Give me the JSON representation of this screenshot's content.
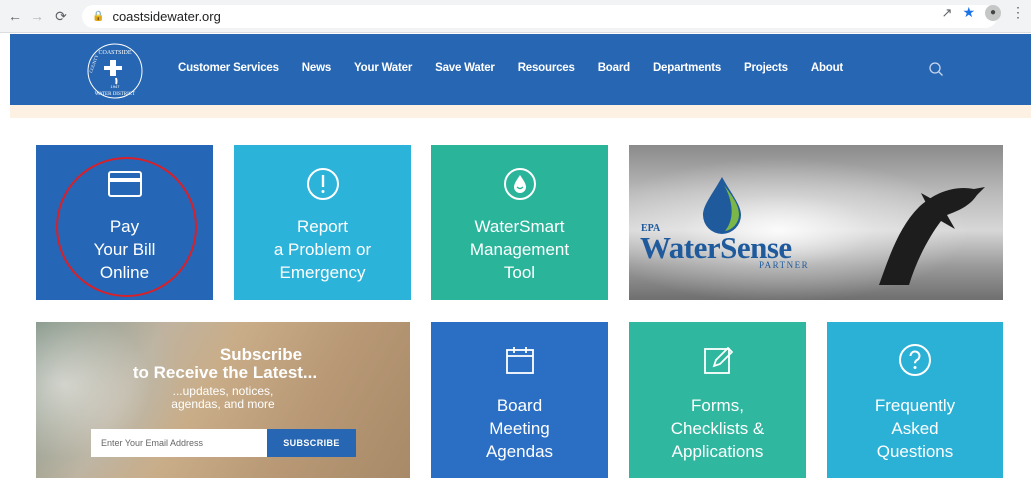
{
  "browser": {
    "url": "coastsidewater.org",
    "back_icon": "arrow-left-icon",
    "forward_icon": "arrow-right-icon",
    "reload_icon": "reload-icon"
  },
  "header": {
    "logo": {
      "text_top": "COASTSIDE",
      "text_bottom": "WATER DISTRICT",
      "text_left": "COUNTY",
      "year": "1947",
      "icon": "faucet-icon"
    },
    "nav": [
      "Customer Services",
      "News",
      "Your Water",
      "Save Water",
      "Resources",
      "Board",
      "Departments",
      "Projects",
      "About"
    ],
    "search_icon": "search-icon"
  },
  "tiles": {
    "pay": {
      "label": "Pay\nYour Bill\nOnline",
      "icon": "credit-card-icon"
    },
    "report": {
      "label": "Report\na Problem or\nEmergency",
      "icon": "exclamation-circle-icon"
    },
    "watersmart": {
      "label": "WaterSmart\nManagement\nTool",
      "icon": "water-drop-icon"
    },
    "watersense": {
      "epa": "EPA",
      "brand": "WaterSense",
      "partner": "PARTNER"
    },
    "subscribe": {
      "title_line1": "Subscribe",
      "title_line2": "to Receive the Latest...",
      "desc": "...updates, notices,\nagendas, and more",
      "email_placeholder": "Enter Your Email Address",
      "button": "SUBSCRIBE"
    },
    "board": {
      "label": "Board\nMeeting\nAgendas",
      "icon": "calendar-icon"
    },
    "forms": {
      "label": "Forms,\nChecklists &\nApplications",
      "icon": "edit-icon"
    },
    "faq": {
      "label": "Frequently\nAsked\nQuestions",
      "icon": "question-circle-icon"
    }
  },
  "colors": {
    "header_blue": "#2766b2",
    "tile_blue": "#2567b6",
    "tile_cyan": "#2cb3d9",
    "tile_teal": "#2ab49a",
    "highlight_red": "#d8202b"
  }
}
